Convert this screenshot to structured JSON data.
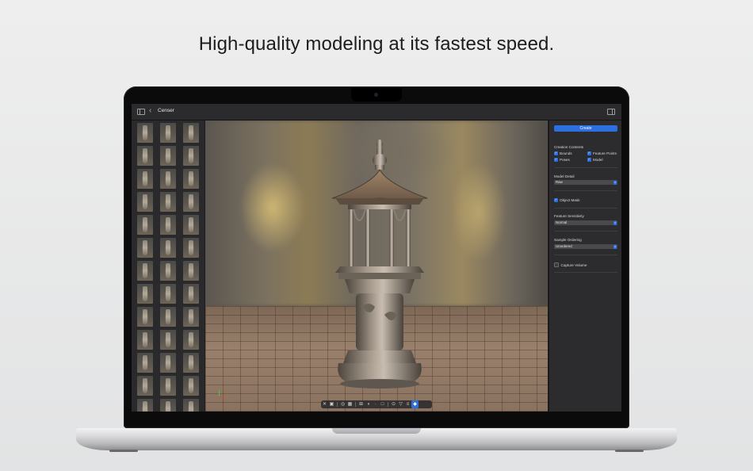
{
  "headline": "High-quality modeling at its fastest speed.",
  "app": {
    "document_title": "Censer",
    "icons": {
      "sidebar": "sidebar-toggle-icon",
      "back": "chevron-left-icon",
      "inspector": "inspector-toggle-icon"
    }
  },
  "inspector": {
    "create_label": "Create",
    "creation_contents": {
      "title": "Creation Contents",
      "options": [
        {
          "label": "Bounds",
          "checked": true
        },
        {
          "label": "Feature Points",
          "checked": true
        },
        {
          "label": "Poses",
          "checked": true
        },
        {
          "label": "Model",
          "checked": true
        }
      ]
    },
    "model_detail": {
      "title": "Model Detail",
      "value": "Raw"
    },
    "object_mask": {
      "label": "Object Mask",
      "checked": true
    },
    "feature_sensitivity": {
      "title": "Feature Sensitivity",
      "value": "Normal"
    },
    "sample_ordering": {
      "title": "Sample Ordering",
      "value": "Unordered"
    },
    "capture_volume": {
      "label": "Capture Volume",
      "checked": false
    }
  },
  "colors": {
    "accent": "#2c6fe0",
    "panel": "#2c2c2f",
    "window": "#1e1e20"
  },
  "thumbnail_grid": {
    "columns": 3,
    "rows": 13
  }
}
